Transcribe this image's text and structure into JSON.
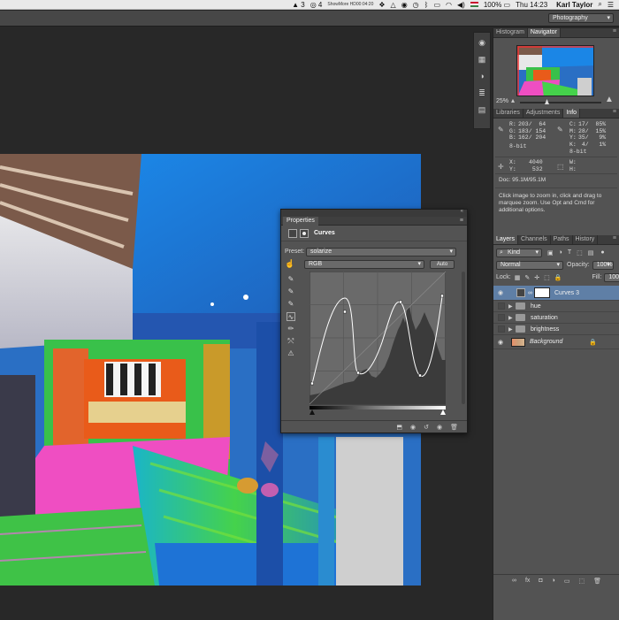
{
  "menubar": {
    "adobe_count": "3",
    "cc_count": "4",
    "showmore_line1": "ShowMore HD",
    "showmore_line2": "00:04:20",
    "battery": "100%",
    "clock": "Thu 14:23",
    "user": "Karl Taylor"
  },
  "options_bar": {
    "workspace": "Photography"
  },
  "properties": {
    "tab": "Properties",
    "title": "Curves",
    "preset_label": "Preset:",
    "preset_value": "solarize",
    "channel": "RGB",
    "auto_label": "Auto"
  },
  "navigator": {
    "tabs": [
      "Histogram",
      "Navigator"
    ],
    "zoom": "25%"
  },
  "info": {
    "tabs": [
      "Libraries",
      "Adjustments",
      "Info"
    ],
    "rgb_labels": "R:\nG:\nB:",
    "rgb_values": "203/  64\n183/ 154\n162/ 204",
    "cmyk_labels": "C:\nM:\nY:\nK:",
    "cmyk_values": "17/  85%\n28/  15%\n35/   9%\n 4/   1%",
    "bits_left": "8-bit",
    "bits_right": "8-bit",
    "xy_labels": "X:\nY:",
    "xy_values": "4040\n 532",
    "wh_labels": "W:\nH:",
    "doc": "Doc: 95.1M/95.1M",
    "hint": "Click image to zoom in, click and drag to marquee zoom.  Use Opt and Cmd for additional options."
  },
  "layers": {
    "tabs": [
      "Layers",
      "Channels",
      "Paths",
      "History"
    ],
    "filter": "Kind",
    "blend_mode": "Normal",
    "opacity_label": "Opacity:",
    "opacity_value": "100%",
    "lock_label": "Lock:",
    "fill_label": "Fill:",
    "fill_value": "100%",
    "items": [
      {
        "name": "Curves 3",
        "selected": true
      },
      {
        "name": "hue"
      },
      {
        "name": "saturation"
      },
      {
        "name": "brightness"
      },
      {
        "name": "Background"
      }
    ]
  },
  "colors": {
    "ui_dark": "#282828",
    "panel": "#535353",
    "selection": "#5f7fa6"
  }
}
